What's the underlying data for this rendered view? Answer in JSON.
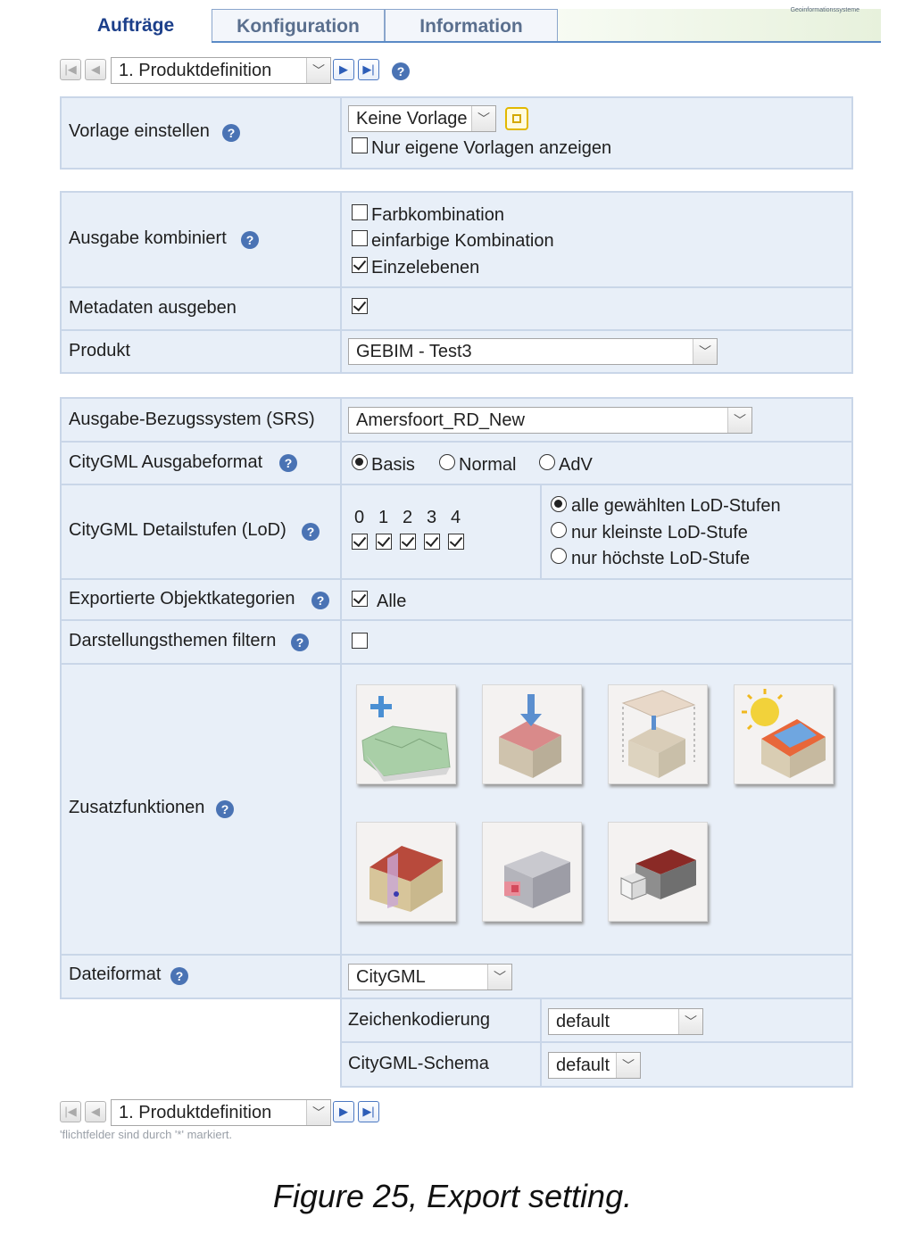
{
  "tabs": [
    {
      "label": "Aufträge",
      "active": true
    },
    {
      "label": "Konfiguration",
      "active": false
    },
    {
      "label": "Information",
      "active": false
    }
  ],
  "nav": {
    "step_value": "1. Produktdefinition"
  },
  "vorlage": {
    "label": "Vorlage einstellen",
    "value": "Keine Vorlage",
    "own_only_label": "Nur eigene Vorlagen anzeigen",
    "own_only_checked": false
  },
  "ausgabe": {
    "label": "Ausgabe kombiniert",
    "options": [
      {
        "label": "Farbkombination",
        "checked": false
      },
      {
        "label": "einfarbige Kombination",
        "checked": false
      },
      {
        "label": "Einzelebenen",
        "checked": true
      }
    ]
  },
  "metadaten": {
    "label": "Metadaten ausgeben",
    "checked": true
  },
  "produkt": {
    "label": "Produkt",
    "value": "GEBIM - Test3"
  },
  "srs": {
    "label": "Ausgabe-Bezugssystem (SRS)",
    "value": "Amersfoort_RD_New"
  },
  "format": {
    "label": "CityGML Ausgabeformat",
    "options": [
      {
        "label": "Basis",
        "checked": true
      },
      {
        "label": "Normal",
        "checked": false
      },
      {
        "label": "AdV",
        "checked": false
      }
    ]
  },
  "lod": {
    "label": "CityGML Detailstufen (LoD)",
    "levels": [
      {
        "label": "0",
        "checked": true
      },
      {
        "label": "1",
        "checked": true
      },
      {
        "label": "2",
        "checked": true
      },
      {
        "label": "3",
        "checked": true
      },
      {
        "label": "4",
        "checked": true
      }
    ],
    "modes": [
      {
        "label": "alle gewählten LoD-Stufen",
        "checked": true
      },
      {
        "label": "nur kleinste LoD-Stufe",
        "checked": false
      },
      {
        "label": "nur höchste LoD-Stufe",
        "checked": false
      }
    ]
  },
  "objekt": {
    "label": "Exportierte Objektkategorien",
    "all_label": "Alle",
    "checked": true
  },
  "themen": {
    "label": "Darstellungsthemen filtern",
    "checked": false
  },
  "zusatz": {
    "label": "Zusatzfunktionen",
    "icons": [
      "terrain-add-icon",
      "building-drop-icon",
      "texture-map-icon",
      "solar-roof-icon",
      "building-section-icon",
      "building-cut-icon",
      "building-block-icon"
    ]
  },
  "datei": {
    "label": "Dateiformat",
    "value": "CityGML",
    "encoding_label": "Zeichenkodierung",
    "encoding_value": "default",
    "schema_label": "CityGML-Schema",
    "schema_value": "default"
  },
  "footnote": "'flichtfelder sind durch '*' markiert.",
  "caption": "Figure 25, Export setting.",
  "colors": {
    "row_bg": "#e8eff8",
    "border": "#c9d6e8",
    "tab_active": "#1c3f8a",
    "help": "#4a73b4"
  }
}
